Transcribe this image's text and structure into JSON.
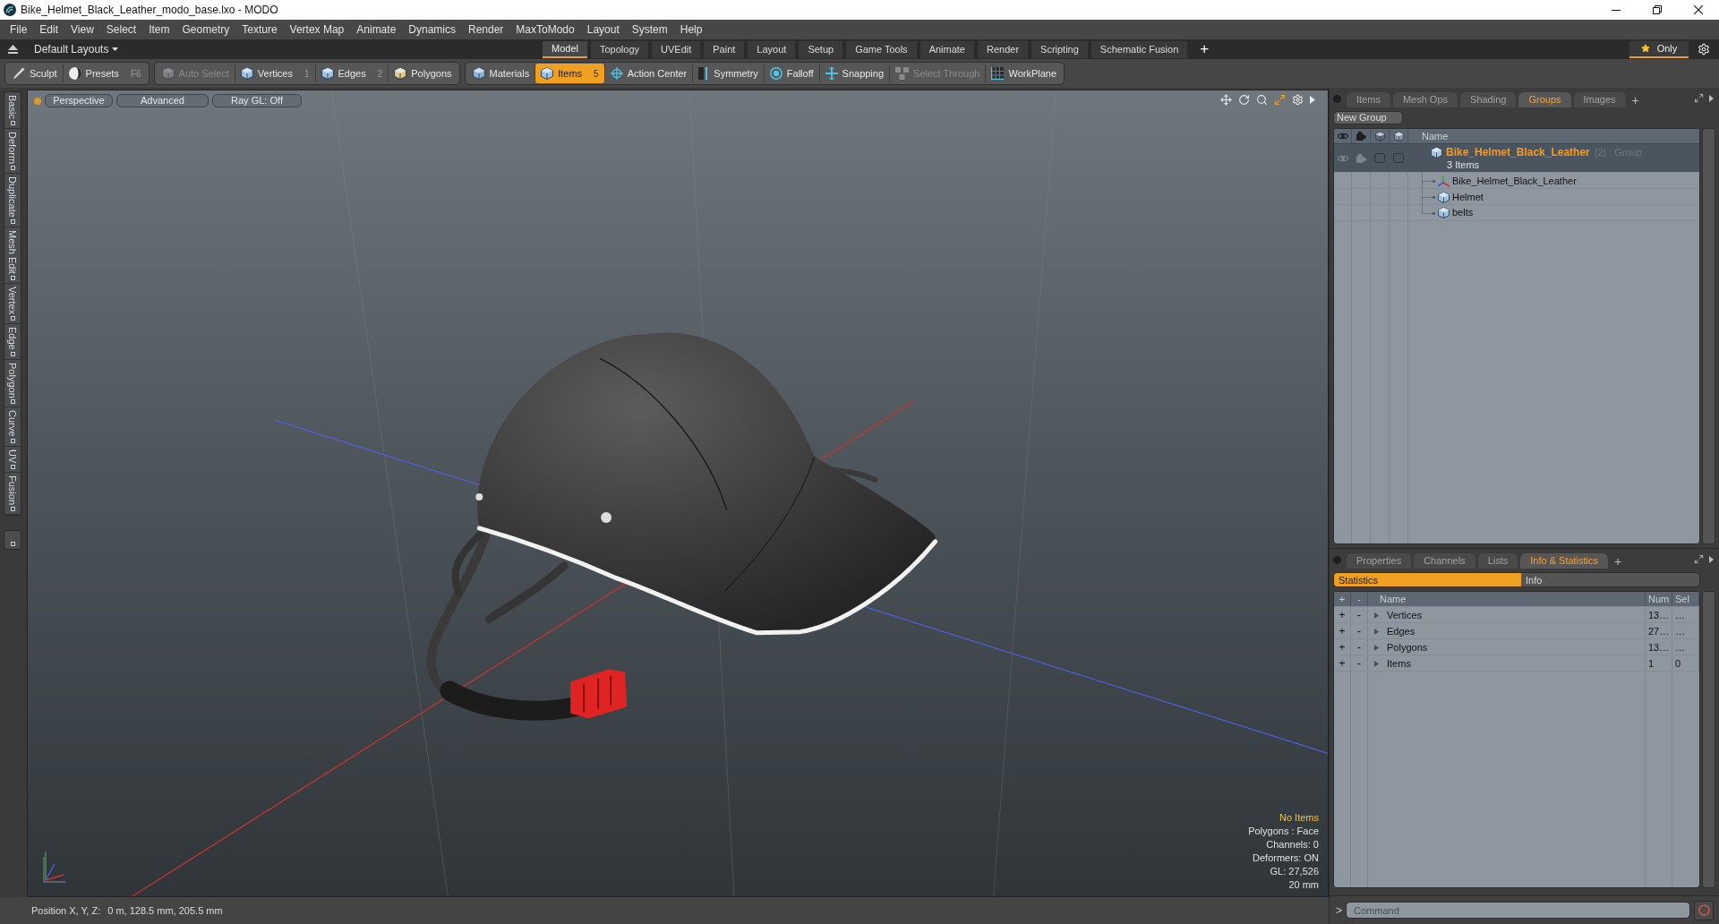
{
  "window": {
    "title": "Bike_Helmet_Black_Leather_modo_base.lxo - MODO"
  },
  "menu_bar": [
    "File",
    "Edit",
    "View",
    "Select",
    "Item",
    "Geometry",
    "Texture",
    "Vertex Map",
    "Animate",
    "Dynamics",
    "Render",
    "MaxToModo",
    "Layout",
    "System",
    "Help"
  ],
  "layout_bar": {
    "layout_menu": "Default Layouts",
    "tabs": [
      {
        "label": "Model",
        "selected": true
      },
      {
        "label": "Topology",
        "selected": false
      },
      {
        "label": "UVEdit",
        "selected": false
      },
      {
        "label": "Paint",
        "selected": false
      },
      {
        "label": "Layout",
        "selected": false
      },
      {
        "label": "Setup",
        "selected": false
      },
      {
        "label": "Game Tools",
        "selected": false
      },
      {
        "label": "Animate",
        "selected": false
      },
      {
        "label": "Render",
        "selected": false
      },
      {
        "label": "Scripting",
        "selected": false
      },
      {
        "label": "Schematic Fusion",
        "selected": false
      }
    ],
    "add_tab": "+",
    "only_toggle": {
      "label": "Only",
      "on": true
    }
  },
  "toolbar": {
    "groups": [
      [
        {
          "label": "Sculpt",
          "selected": false,
          "disabled": false
        },
        {
          "label": "Presets",
          "shortcut": "F6",
          "selected": false,
          "disabled": false
        }
      ],
      [
        {
          "label": "Auto Select",
          "selected": false,
          "disabled": true
        },
        {
          "label": "Vertices",
          "shortcut": "1",
          "selected": false,
          "disabled": false
        },
        {
          "label": "Edges",
          "shortcut": "2",
          "selected": false,
          "disabled": false
        },
        {
          "label": "Polygons",
          "selected": false,
          "disabled": false
        }
      ],
      [
        {
          "label": "Materials",
          "selected": false,
          "disabled": false
        },
        {
          "label": "Items",
          "shortcut": "5",
          "selected": true,
          "disabled": false
        },
        {
          "label": "Action Center",
          "selected": false,
          "disabled": false
        },
        {
          "label": "Symmetry",
          "selected": false,
          "disabled": false
        },
        {
          "label": "Falloff",
          "selected": false,
          "disabled": false
        },
        {
          "label": "Snapping",
          "selected": false,
          "disabled": false
        },
        {
          "label": "Select Through",
          "selected": false,
          "disabled": true
        },
        {
          "label": "WorkPlane",
          "selected": false,
          "disabled": false
        }
      ]
    ]
  },
  "side_tabs": [
    "Basic",
    "Deform",
    "Duplicate",
    "Mesh Edit",
    "Vertex",
    "Edge",
    "Polygon",
    "Curve",
    "UV",
    "Fusion"
  ],
  "viewport": {
    "buttons": [
      "Perspective",
      "Advanced",
      "Ray GL: Off"
    ],
    "info": [
      {
        "text": "No Items",
        "highlight": true
      },
      {
        "text": "Polygons : Face",
        "highlight": false
      },
      {
        "text": "Channels: 0",
        "highlight": false
      },
      {
        "text": "Deformers: ON",
        "highlight": false
      },
      {
        "text": "GL: 27,526",
        "highlight": false
      },
      {
        "text": "20 mm",
        "highlight": false
      }
    ]
  },
  "status_bar": {
    "label": "Position X, Y, Z:",
    "value": "0 m, 128.5 mm, 205.5 mm"
  },
  "groups_panel": {
    "tabs": [
      {
        "label": "Items",
        "selected": false
      },
      {
        "label": "Mesh Ops",
        "selected": false
      },
      {
        "label": "Shading",
        "selected": false
      },
      {
        "label": "Groups",
        "selected": true
      },
      {
        "label": "Images",
        "selected": false
      }
    ],
    "add_tab": "+",
    "new_group_button": "New Group",
    "name_column": "Name",
    "group": {
      "name": "Bike_Helmet_Black_Leather",
      "count": "(2)",
      "type": ": Group",
      "subtitle": "3 Items",
      "children": [
        {
          "name": "Bike_Helmet_Black_Leather",
          "kind": "locator"
        },
        {
          "name": "Helmet",
          "kind": "mesh"
        },
        {
          "name": "belts",
          "kind": "mesh"
        }
      ]
    }
  },
  "stats_panel": {
    "tabs": [
      {
        "label": "Properties",
        "selected": false
      },
      {
        "label": "Channels",
        "selected": false
      },
      {
        "label": "Lists",
        "selected": false
      },
      {
        "label": "Info & Statistics",
        "selected": true
      }
    ],
    "add_tab": "+",
    "modes": [
      {
        "label": "Statistics",
        "selected": true
      },
      {
        "label": "Info",
        "selected": false
      }
    ],
    "columns": [
      "+",
      "-",
      "Name",
      "Num",
      "Sel"
    ],
    "rows": [
      {
        "add": "+",
        "remove": "-",
        "name": "Vertices",
        "num": "13…",
        "sel": "…",
        "expanded": false
      },
      {
        "add": "+",
        "remove": "-",
        "name": "Edges",
        "num": "27…",
        "sel": "…",
        "expanded": false
      },
      {
        "add": "+",
        "remove": "-",
        "name": "Polygons",
        "num": "13…",
        "sel": "…",
        "expanded": false
      },
      {
        "add": "+",
        "remove": "-",
        "name": "Items",
        "num": "1",
        "sel": "0",
        "expanded": false
      }
    ]
  },
  "command_line": {
    "prompt": ">",
    "placeholder": "Command"
  }
}
